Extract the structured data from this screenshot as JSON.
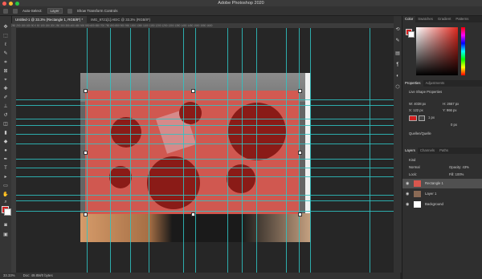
{
  "window": {
    "title": "Adobe Photoshop 2020"
  },
  "options_bar": {
    "auto_select_label": "Auto-Select:",
    "auto_select_value": "Layer",
    "show_transform_label": "Show Transform Controls"
  },
  "tabs": [
    {
      "label": "Untitled-1 @ 33.3% (Rectangle 1, RGB/8*) *"
    },
    {
      "label": "IMG_9721[1].HEIC @ 33.3% (RGB/8*)"
    }
  ],
  "ruler": {
    "ticks": "250 200 150 100 50 0 50 100 150 200 250 300 350 400 450 500 550 600 650 700 750 800 850 900 950 1000 1050 1100 1150 1200 1250 1300 1350 1400 1450 1500 1550 1600"
  },
  "status": {
    "zoom": "33.33%",
    "doc": "Doc: 49.8M/0 bytes"
  },
  "color_panel": {
    "tabs": [
      "Color",
      "Swatches",
      "Gradient",
      "Patterns"
    ],
    "fg_color": "#d21f1f"
  },
  "properties_panel": {
    "tabs": [
      "Properties",
      "Adjustments"
    ],
    "heading": "Live Shape Properties",
    "w": "W: 4038 px",
    "h": "H: 2667 px",
    "x": "X: 122 px",
    "y": "Y: 966 px",
    "stroke_size": "1 px",
    "radius": "0 px",
    "ops_label": "Quellen/Quelle"
  },
  "layers_panel": {
    "tabs": [
      "Layers",
      "Channels",
      "Paths"
    ],
    "kind_label": "Kind",
    "blend_mode": "Normal",
    "opacity": "Opacity: 43%",
    "lock_label": "Lock:",
    "fill": "Fill: 100%",
    "layers": [
      {
        "name": "Rectangle 1"
      },
      {
        "name": "Layer 1"
      },
      {
        "name": "Background"
      }
    ]
  },
  "colors": {
    "accent_red": "#d9574e",
    "circle_red": "#8a1b17",
    "guide": "#2fc4c4"
  }
}
